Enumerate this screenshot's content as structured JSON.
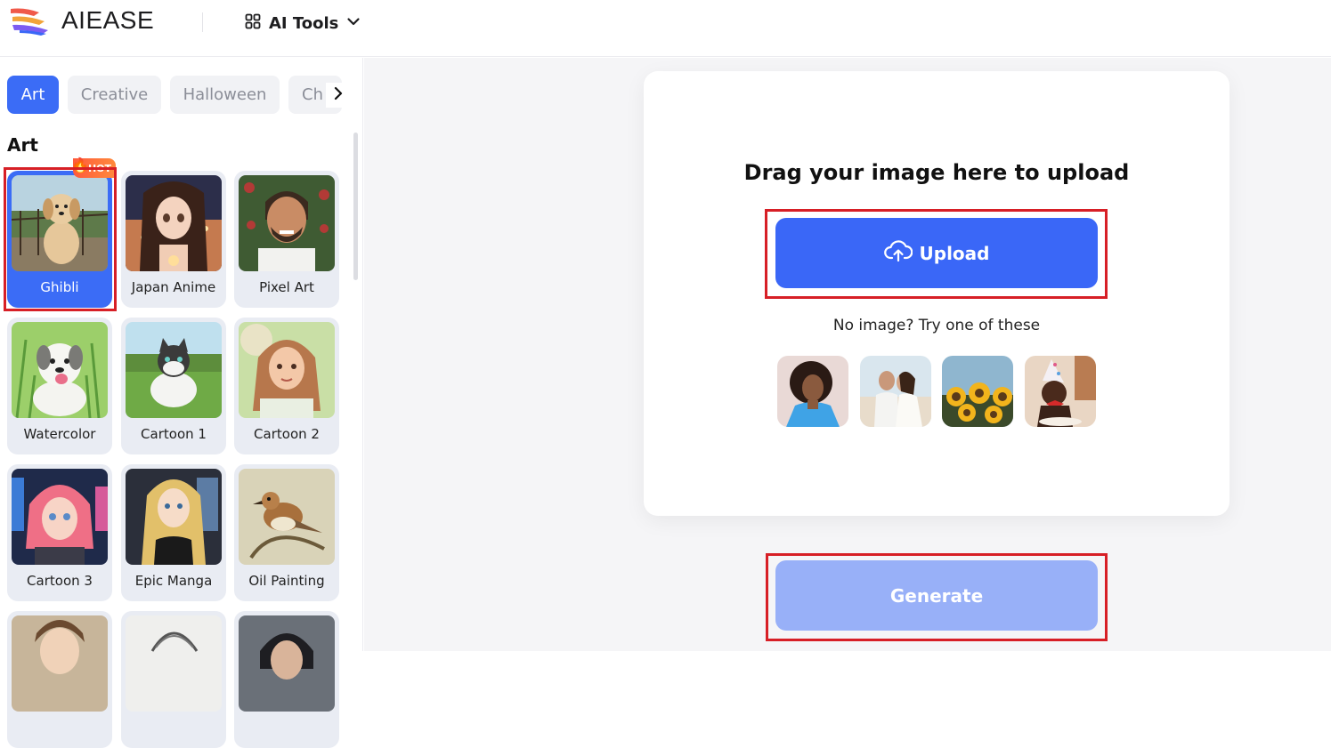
{
  "header": {
    "brand": "AIEASE",
    "ai_tools_label": "AI Tools",
    "logo_colors": [
      "#f05a4a",
      "#f2a43a",
      "#7c5cf2",
      "#3a67f7"
    ]
  },
  "sidebar": {
    "tabs": [
      {
        "label": "Art",
        "active": true
      },
      {
        "label": "Creative",
        "active": false
      },
      {
        "label": "Halloween",
        "active": false
      },
      {
        "label": "Ch",
        "active": false
      }
    ],
    "section_title": "Art",
    "styles": [
      {
        "label": "Ghibli",
        "selected": true,
        "badge": "HOT"
      },
      {
        "label": "Japan Anime"
      },
      {
        "label": "Pixel Art"
      },
      {
        "label": "Watercolor"
      },
      {
        "label": "Cartoon 1"
      },
      {
        "label": "Cartoon 2"
      },
      {
        "label": "Cartoon 3"
      },
      {
        "label": "Epic Manga"
      },
      {
        "label": "Oil Painting"
      },
      {
        "label": ""
      },
      {
        "label": ""
      },
      {
        "label": ""
      }
    ]
  },
  "main": {
    "drag_title": "Drag your image here to upload",
    "upload_label": "Upload",
    "no_image_text": "No image? Try one of these",
    "samples": [
      "woman-blue-jacket",
      "wedding-couple",
      "sunflowers",
      "party-dog"
    ],
    "generate_label": "Generate"
  },
  "colors": {
    "accent": "#3a67f7",
    "accent_disabled": "#98b0f8",
    "highlight": "#d71f26"
  }
}
